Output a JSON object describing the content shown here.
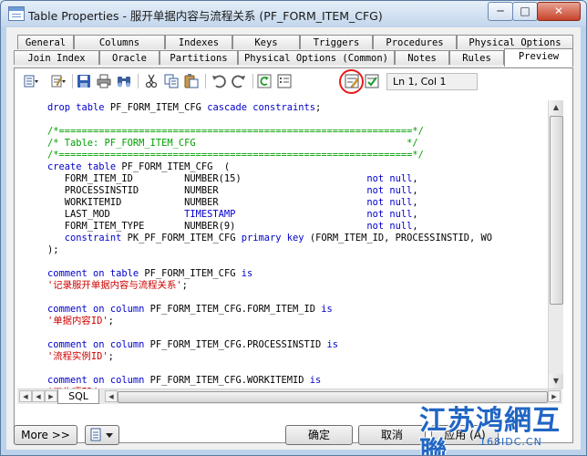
{
  "window": {
    "title": "Table Properties - 服开单据内容与流程关系 (PF_FORM_ITEM_CFG)",
    "minimize": "─",
    "maximize": "□",
    "close": "✕"
  },
  "tabs": {
    "row1": [
      "General",
      "Columns",
      "Indexes",
      "Keys",
      "Triggers",
      "Procedures",
      "Physical Options"
    ],
    "row2": [
      "Join Index",
      "Oracle",
      "Partitions",
      "Physical Options (Common)",
      "Notes",
      "Rules",
      "Preview"
    ],
    "active": "Preview"
  },
  "toolbar": {
    "icons": [
      "properties-dropdown-icon",
      "edit-dropdown-icon",
      "save-icon",
      "print-icon",
      "find-icon",
      "cut-icon",
      "copy-icon",
      "paste-icon",
      "undo-icon",
      "redo-icon",
      "refresh-icon",
      "show-generation-options-icon",
      "change-generation-options-icon",
      "validate-icon"
    ],
    "position_status": "Ln 1, Col 1",
    "highlight_color": "#e81a1a"
  },
  "editor": {
    "lines": [
      [
        {
          "t": "drop table ",
          "k": "k"
        },
        {
          "t": "PF_FORM_ITEM_CFG ",
          "k": "n"
        },
        {
          "t": "cascade constraints",
          "k": "k"
        },
        {
          "t": ";",
          "k": "n"
        }
      ],
      [
        {
          "t": "",
          "k": "n"
        }
      ],
      [
        {
          "t": "/*==============================================================*/",
          "k": "c"
        }
      ],
      [
        {
          "t": "/* Table: PF_FORM_ITEM_CFG                                     */",
          "k": "c"
        }
      ],
      [
        {
          "t": "/*==============================================================*/",
          "k": "c"
        }
      ],
      [
        {
          "t": "create table ",
          "k": "k"
        },
        {
          "t": "PF_FORM_ITEM_CFG  (",
          "k": "n"
        }
      ],
      [
        {
          "t": "   FORM_ITEM_ID         NUMBER(15)                      ",
          "k": "n"
        },
        {
          "t": "not null",
          "k": "k"
        },
        {
          "t": ",",
          "k": "n"
        }
      ],
      [
        {
          "t": "   PROCESSINSTID        NUMBER                          ",
          "k": "n"
        },
        {
          "t": "not null",
          "k": "k"
        },
        {
          "t": ",",
          "k": "n"
        }
      ],
      [
        {
          "t": "   WORKITEMID           NUMBER                          ",
          "k": "n"
        },
        {
          "t": "not null",
          "k": "k"
        },
        {
          "t": ",",
          "k": "n"
        }
      ],
      [
        {
          "t": "   LAST_MOD             ",
          "k": "n"
        },
        {
          "t": "TIMESTAMP",
          "k": "t"
        },
        {
          "t": "                       ",
          "k": "n"
        },
        {
          "t": "not null",
          "k": "k"
        },
        {
          "t": ",",
          "k": "n"
        }
      ],
      [
        {
          "t": "   FORM_ITEM_TYPE       NUMBER(9)                       ",
          "k": "n"
        },
        {
          "t": "not null",
          "k": "k"
        },
        {
          "t": ",",
          "k": "n"
        }
      ],
      [
        {
          "t": "   ",
          "k": "n"
        },
        {
          "t": "constraint ",
          "k": "k"
        },
        {
          "t": "PK_PF_FORM_ITEM_CFG ",
          "k": "n"
        },
        {
          "t": "primary key ",
          "k": "k"
        },
        {
          "t": "(FORM_ITEM_ID, PROCESSINSTID, WO",
          "k": "n"
        }
      ],
      [
        {
          "t": ");",
          "k": "n"
        }
      ],
      [
        {
          "t": "",
          "k": "n"
        }
      ],
      [
        {
          "t": "comment on table ",
          "k": "k"
        },
        {
          "t": "PF_FORM_ITEM_CFG ",
          "k": "n"
        },
        {
          "t": "is",
          "k": "k"
        }
      ],
      [
        {
          "t": "'记录服开单据内容与流程关系'",
          "k": "s"
        },
        {
          "t": ";",
          "k": "n"
        }
      ],
      [
        {
          "t": "",
          "k": "n"
        }
      ],
      [
        {
          "t": "comment on column ",
          "k": "k"
        },
        {
          "t": "PF_FORM_ITEM_CFG.FORM_ITEM_ID ",
          "k": "n"
        },
        {
          "t": "is",
          "k": "k"
        }
      ],
      [
        {
          "t": "'单据内容ID'",
          "k": "s"
        },
        {
          "t": ";",
          "k": "n"
        }
      ],
      [
        {
          "t": "",
          "k": "n"
        }
      ],
      [
        {
          "t": "comment on column ",
          "k": "k"
        },
        {
          "t": "PF_FORM_ITEM_CFG.PROCESSINSTID ",
          "k": "n"
        },
        {
          "t": "is",
          "k": "k"
        }
      ],
      [
        {
          "t": "'流程实例ID'",
          "k": "s"
        },
        {
          "t": ";",
          "k": "n"
        }
      ],
      [
        {
          "t": "",
          "k": "n"
        }
      ],
      [
        {
          "t": "comment on column ",
          "k": "k"
        },
        {
          "t": "PF_FORM_ITEM_CFG.WORKITEMID ",
          "k": "n"
        },
        {
          "t": "is",
          "k": "k"
        }
      ],
      [
        {
          "t": "'工作项ID'",
          "k": "s"
        },
        {
          "t": ";",
          "k": "n"
        }
      ]
    ]
  },
  "bottom": {
    "sql_tab": "SQL"
  },
  "footer": {
    "more": "More >>",
    "ok": "确定",
    "cancel": "取消",
    "apply": "应用 (A)"
  },
  "watermark": {
    "main": "江苏鸿網互聯",
    "sub": "168IDC.CN"
  }
}
